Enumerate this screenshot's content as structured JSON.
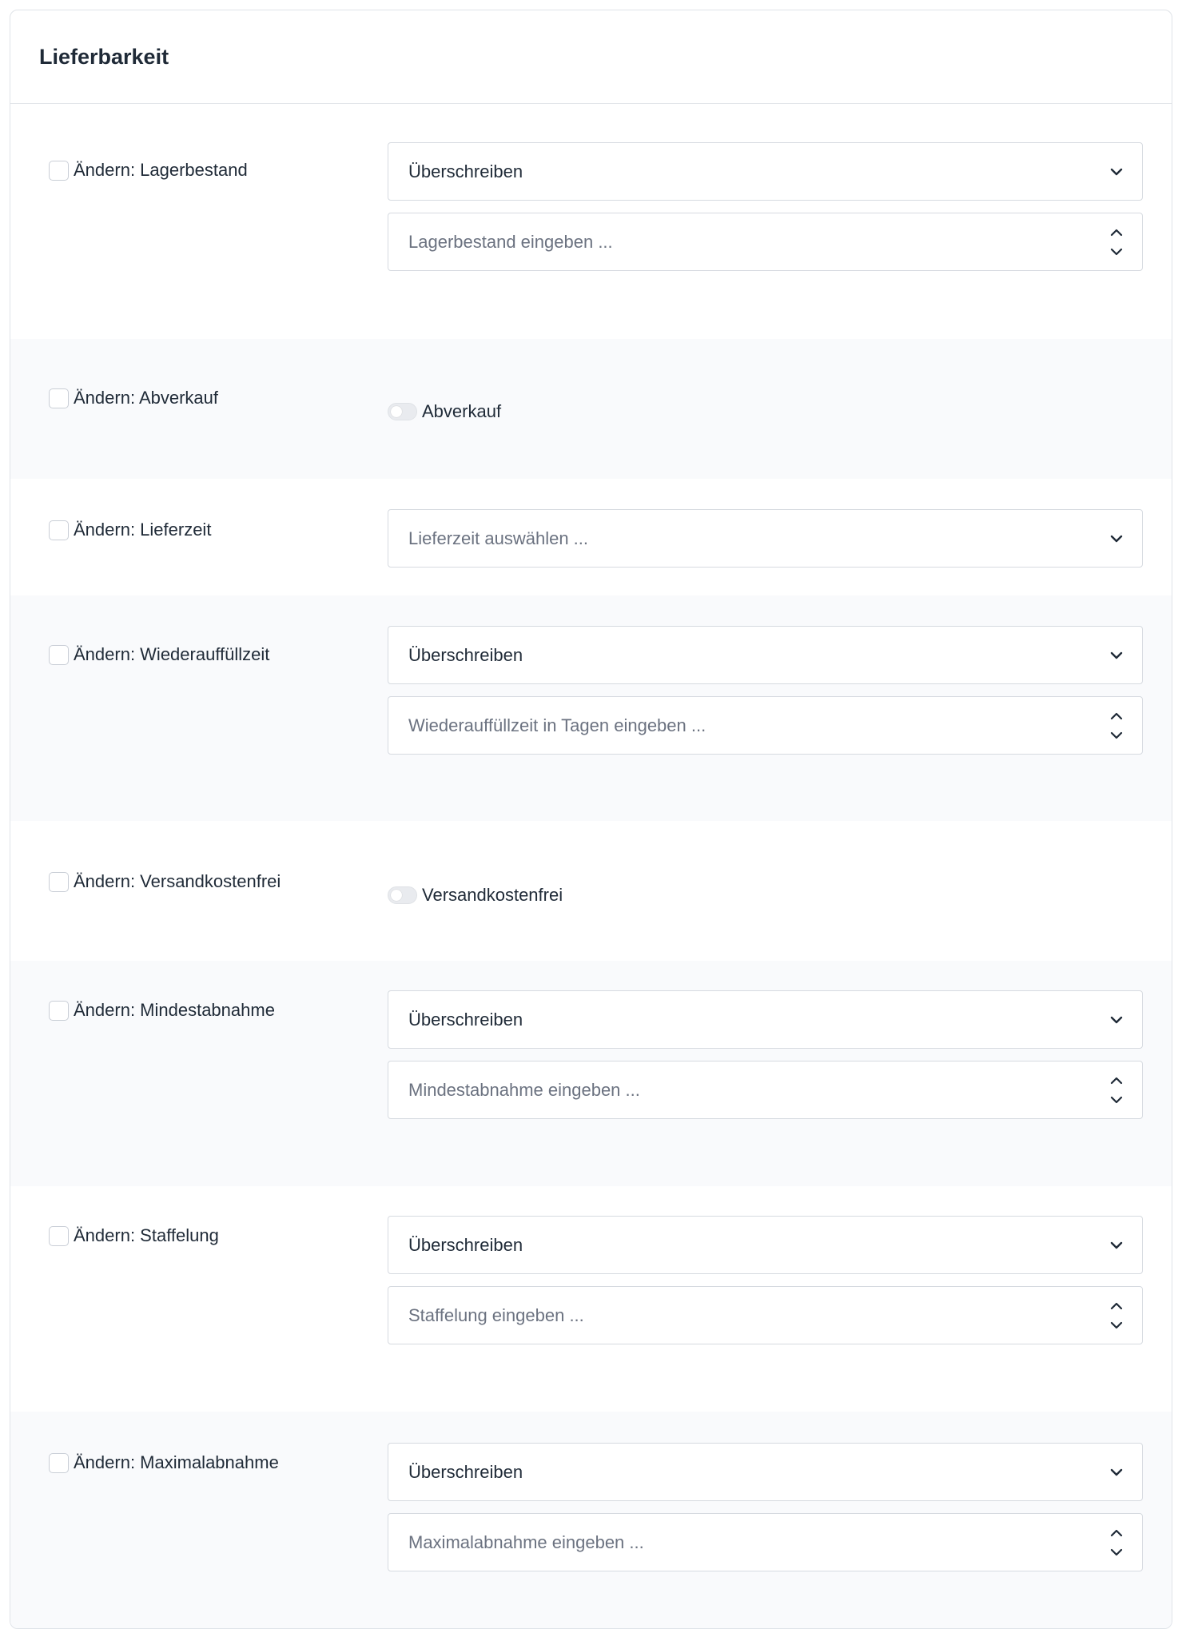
{
  "card": {
    "title": "Lieferbarkeit"
  },
  "rows": [
    {
      "checkbox_label": "Ändern: Lagerbestand",
      "select_value": "Überschreiben",
      "input_placeholder": "Lagerbestand eingeben ..."
    },
    {
      "checkbox_label": "Ändern: Abverkauf",
      "toggle_label": "Abverkauf",
      "toggle_on": false
    },
    {
      "checkbox_label": "Ändern: Lieferzeit",
      "select_placeholder": "Lieferzeit auswählen ..."
    },
    {
      "checkbox_label": "Ändern: Wiederauffüllzeit",
      "select_value": "Überschreiben",
      "input_placeholder": "Wiederauffüllzeit in Tagen eingeben ..."
    },
    {
      "checkbox_label": "Ändern: Versandkostenfrei",
      "toggle_label": "Versandkostenfrei",
      "toggle_on": false
    },
    {
      "checkbox_label": "Ändern: Mindestabnahme",
      "select_value": "Überschreiben",
      "input_placeholder": "Mindestabnahme eingeben ..."
    },
    {
      "checkbox_label": "Ändern: Staffelung",
      "select_value": "Überschreiben",
      "input_placeholder": "Staffelung eingeben  ..."
    },
    {
      "checkbox_label": "Ändern: Maximalabnahme",
      "select_value": "Überschreiben",
      "input_placeholder": "Maximalabnahme eingeben ..."
    }
  ],
  "icons": {
    "dropdown": "chevron-down-icon",
    "stepper": "stepper-arrows-icon"
  },
  "colors": {
    "border": "#d6dae0",
    "row_alt_bg": "#f9fafc",
    "text": "#1f2a37",
    "placeholder": "#6b7280"
  }
}
